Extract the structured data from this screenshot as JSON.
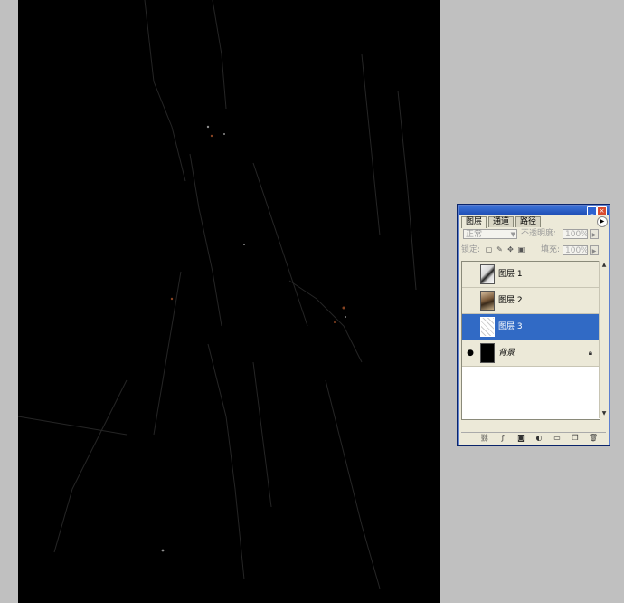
{
  "panel": {
    "tabs": [
      "图层",
      "通道",
      "路径"
    ],
    "blend_mode": "正常",
    "opacity_label": "不透明度:",
    "opacity_value": "100%",
    "lock_label": "锁定:",
    "fill_label": "填充:",
    "fill_value": "100%",
    "layers": [
      {
        "name": "图层 1",
        "visible": false,
        "selected": false,
        "thumb": "portrait"
      },
      {
        "name": "图层 2",
        "visible": false,
        "selected": false,
        "thumb": "sepia"
      },
      {
        "name": "图层 3",
        "visible": false,
        "selected": true,
        "thumb": "sketch"
      },
      {
        "name": "背景",
        "visible": true,
        "selected": false,
        "thumb": "black",
        "locked": true
      }
    ]
  },
  "icons": {
    "eye": "eye-icon",
    "lock": "lock-icon",
    "link": "link-icon",
    "style": "layer-style-icon",
    "mask": "layer-mask-icon",
    "adjust": "adjustment-layer-icon",
    "group": "new-group-icon",
    "new": "new-layer-icon",
    "trash": "trash-icon"
  },
  "colors": {
    "selection": "#316ac5",
    "panel_bg": "#ece9d8",
    "titlebar": "#1f4fb6",
    "canvas": "#000000",
    "workspace": "#c0c0c0"
  }
}
